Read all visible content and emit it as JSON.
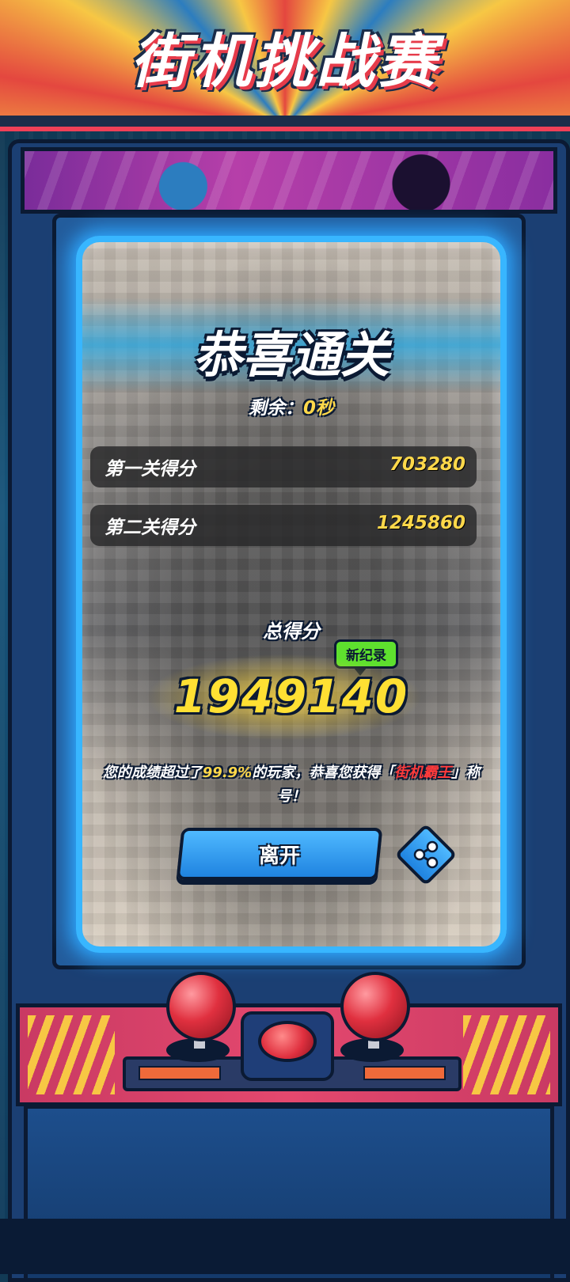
{
  "banner": {
    "title": "街机挑战赛"
  },
  "result": {
    "title": "恭喜通关",
    "remaining_label": "剩余：",
    "remaining_value": "0秒"
  },
  "scores": [
    {
      "label": "第一关得分",
      "value": "703280"
    },
    {
      "label": "第二关得分",
      "value": "1245860"
    }
  ],
  "total": {
    "label": "总得分",
    "badge": "新纪录",
    "value": "1949140"
  },
  "message": {
    "prefix": "您的成绩超过了",
    "percent": "99.9%",
    "middle": "的玩家，恭喜您获得「",
    "title_name": "街机霸王",
    "suffix": "」称号！"
  },
  "actions": {
    "leave_label": "离开",
    "share_icon": "share-icon"
  },
  "colors": {
    "accent_yellow": "#ffd84a",
    "button_blue": "#1f83e0",
    "badge_green": "#5ee02e",
    "highlight_red": "#ff3b3b"
  }
}
